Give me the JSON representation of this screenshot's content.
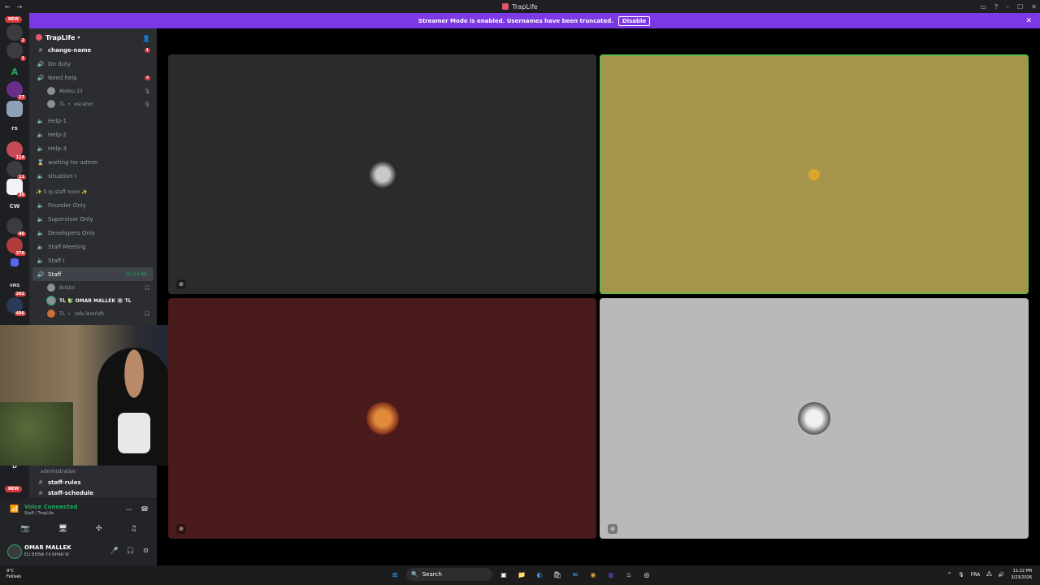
{
  "window": {
    "title": "TrapLife",
    "window_buttons": [
      "–",
      "☐",
      "✕"
    ]
  },
  "banner": {
    "message": "Streamer Mode is enabled. Usernames have been truncated.",
    "disable_label": "Disable",
    "close_glyph": "✕"
  },
  "servers": {
    "new_label": "NEW",
    "items": [
      {
        "label": "",
        "badge": "2"
      },
      {
        "label": "",
        "badge": "1"
      },
      {
        "label": "A",
        "badge": ""
      },
      {
        "label": "",
        "badge": "27"
      },
      {
        "label": "",
        "badge": ""
      },
      {
        "label": "rs",
        "badge": ""
      },
      {
        "label": "",
        "badge": "114"
      },
      {
        "label": "",
        "badge": "11"
      },
      {
        "label": "",
        "badge": "30"
      },
      {
        "label": "CW",
        "badge": ""
      },
      {
        "label": "",
        "badge": "40"
      },
      {
        "label": "",
        "badge": "376"
      },
      {
        "label": "",
        "badge": ""
      },
      {
        "label": "VMS",
        "badge": "292"
      },
      {
        "label": "",
        "badge": "406"
      },
      {
        "label": "D",
        "badge": ""
      }
    ]
  },
  "sidebar": {
    "guild_name": "TrapLife",
    "channels_top": [
      {
        "name": "change-name",
        "type": "text",
        "count": "1"
      },
      {
        "name": "On duty",
        "type": "voice",
        "count": ""
      },
      {
        "name": "Need help",
        "type": "voice-red",
        "count": "4"
      }
    ],
    "need_help_users": [
      {
        "name": "Abdou 23"
      },
      {
        "name": "TL 🔹 escanor"
      }
    ],
    "channels_mid": [
      {
        "name": "Help-1"
      },
      {
        "name": "Help-2"
      },
      {
        "name": "Help-3"
      },
      {
        "name": "waiting for admin"
      },
      {
        "name": "situation I"
      }
    ],
    "staff_category": "✨ tl rp staff room ✨",
    "staff_channels": [
      {
        "name": "Founder Only"
      },
      {
        "name": "Supervisor Only"
      },
      {
        "name": "Developers Only"
      },
      {
        "name": "Staff Meeting"
      },
      {
        "name": "Staff I"
      }
    ],
    "active_channel": {
      "name": "Staff",
      "timer": "10:23:46"
    },
    "staff_users": [
      {
        "name": "Bristol"
      },
      {
        "name": "TL 🔰 OMAR MALLEK 🔘 TL"
      },
      {
        "name": "TL 🔹 rafa lemridh"
      }
    ],
    "admin_category": "administration",
    "bottom_channels": [
      {
        "name": "staff-rules"
      },
      {
        "name": "staff-schedule"
      }
    ]
  },
  "voice_panel": {
    "status": "Voice Connected",
    "location": "Staff / TrapLife"
  },
  "user_panel": {
    "name": "OMAR MALLEK",
    "status": "ELI BEINA Y.II NHAR W"
  },
  "taskbar": {
    "weather_temp": "9°C",
    "weather_desc": "Fellisés",
    "search_label": "Search",
    "lang": "FRA",
    "time": "11:22 PM",
    "date": "3/23/2026"
  },
  "colors": {
    "tile_top_left": "#2b2b2c",
    "tile_top_right": "#a5954b",
    "tile_bottom_left": "#4a1b1b",
    "tile_bottom_right": "#b9b9bb",
    "speaking_border": "#63b94d",
    "banner": "#7d3ae6"
  }
}
